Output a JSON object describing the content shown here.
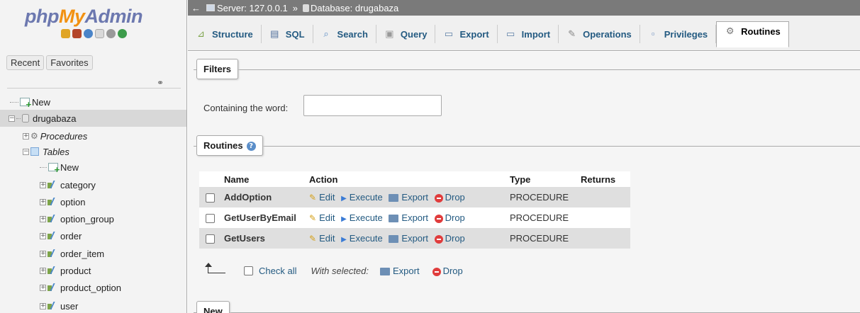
{
  "brand": {
    "part1": "php",
    "part2": "My",
    "part3": "Admin"
  },
  "nav": {
    "toolbar_icons": [
      "home-icon",
      "exit-icon",
      "help-icon",
      "docs-icon",
      "settings-icon",
      "reload-icon"
    ],
    "tabs": {
      "recent": "Recent",
      "favorites": "Favorites"
    },
    "tree": {
      "new_label": "New",
      "database": "drugabaza",
      "procedures": "Procedures",
      "tables": "Tables",
      "tables_new": "New",
      "table_names": [
        "category",
        "option",
        "option_group",
        "order",
        "order_item",
        "product",
        "product_option",
        "user"
      ]
    }
  },
  "breadcrumb": {
    "server": "Server: 127.0.0.1",
    "separator": "»",
    "database": "Database: drugabaza"
  },
  "tabs": [
    {
      "label": "Structure",
      "icon": "structure-icon"
    },
    {
      "label": "SQL",
      "icon": "sql-icon"
    },
    {
      "label": "Search",
      "icon": "search-icon"
    },
    {
      "label": "Query",
      "icon": "query-icon"
    },
    {
      "label": "Export",
      "icon": "export-icon"
    },
    {
      "label": "Import",
      "icon": "import-icon"
    },
    {
      "label": "Operations",
      "icon": "wrench-icon"
    },
    {
      "label": "Privileges",
      "icon": "privileges-icon"
    },
    {
      "label": "Routines",
      "icon": "routines-icon"
    }
  ],
  "filters": {
    "legend": "Filters",
    "label": "Containing the word:",
    "value": ""
  },
  "routines": {
    "legend": "Routines",
    "columns": {
      "name": "Name",
      "action": "Action",
      "type": "Type",
      "returns": "Returns"
    },
    "actions": {
      "edit": "Edit",
      "execute": "Execute",
      "export": "Export",
      "drop": "Drop"
    },
    "rows": [
      {
        "name": "AddOption",
        "type": "PROCEDURE",
        "returns": ""
      },
      {
        "name": "GetUserByEmail",
        "type": "PROCEDURE",
        "returns": ""
      },
      {
        "name": "GetUsers",
        "type": "PROCEDURE",
        "returns": ""
      }
    ],
    "bulk": {
      "check_all": "Check all",
      "with_selected": "With selected:",
      "export": "Export",
      "drop": "Drop"
    }
  },
  "new_section": {
    "legend": "New"
  }
}
